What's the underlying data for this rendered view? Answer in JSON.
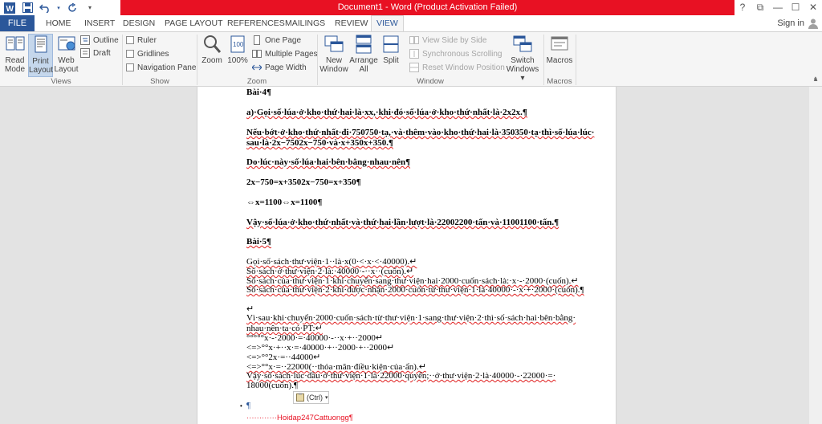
{
  "window": {
    "title": "Document1 - Word (Product Activation Failed)",
    "controls": {
      "help": "?",
      "restore": "⧉",
      "minimize": "—",
      "maximize": "☐",
      "close": "✕"
    }
  },
  "tabs": [
    "FILE",
    "HOME",
    "INSERT",
    "DESIGN",
    "PAGE LAYOUT",
    "REFERENCES",
    "MAILINGS",
    "REVIEW",
    "VIEW"
  ],
  "signin": "Sign in",
  "ribbon": {
    "views": {
      "label": "Views",
      "read_mode": [
        "Read",
        "Mode"
      ],
      "print_layout": [
        "Print",
        "Layout"
      ],
      "web_layout": [
        "Web",
        "Layout"
      ],
      "outline": "Outline",
      "draft": "Draft"
    },
    "show": {
      "label": "Show",
      "ruler": "Ruler",
      "gridlines": "Gridlines",
      "navigation_pane": "Navigation Pane"
    },
    "zoom": {
      "label": "Zoom",
      "zoom": "Zoom",
      "percent": "100%",
      "one_page": "One Page",
      "multiple_pages": "Multiple Pages",
      "page_width": "Page Width"
    },
    "window": {
      "label": "Window",
      "new_window": [
        "New",
        "Window"
      ],
      "arrange_all": [
        "Arrange",
        "All"
      ],
      "split": "Split",
      "view_side_by_side": "View Side by Side",
      "sync_scrolling": "Synchronous Scrolling",
      "reset_position": "Reset Window Position",
      "switch_windows": [
        "Switch",
        "Windows ▾"
      ]
    },
    "macros": {
      "label": "Macros",
      "macros": "Macros"
    }
  },
  "document": {
    "lines": [
      "Bài·4¶",
      "a)·Gọi·số·lúa·ở·kho·thứ·hai·là·xx,·khi·đó·số·lúa·ở·kho·thứ·nhất·là·2x2x.¶",
      "Nếu·bớt·ở·kho·thứ·nhất·đi·750750·tạ,·và·thêm·vào·kho·thứ·hai·là·350350·tạ·thì·số·lúa·lúc·",
      "sau·là·2x−7502x−750·và·x+350x+350.¶",
      "Do·lúc·này·số·lúa·hai·bên·bằng·nhau·nên¶",
      "2x−750=x+3502x−750=x+350¶",
      "⇔x=1100⇔x=1100¶",
      "Vậy·số·lúa·ở·kho·thứ·nhất·và·thứ·hai·lần·lượt·là·22002200·tấn·và·11001100·tấn.¶",
      "Bài·5¶",
      "Gọi·số·sách·thư·viện·1··là·x(0·<·x·<·40000).↵",
      "Số·sách·ở·thư·viện·2·là:·40000·-··x··(cuốn).↵",
      "Số·sách·của·thư·viện·1·khi·chuyển·sang·thư·viện·hai·2000·cuốn·sách·là:·x·-·2000·(cuốn).↵",
      "Số·sách·của·thư·viện·2·khi·được·nhận·2000·cuốn·từ·thư·viện·1·là·40000·-·x·+·2000·(cuốn).¶",
      "↵",
      "Vì·sau·khi·chuyển·2000·cuốn·sách·từ·thư·viện·1·sang·thư·viện·2·thì·số·sách·hai·bên·bằng·",
      "nhau·nên·ta·có·PT:↵",
      "°°°°°x·-·2000·=·40000·-··x·+··2000↵",
      "<=>°°x·+··x·=·40000·+··2000·+··2000↵",
      "<=>°°2x·=··44000↵",
      "<=>°°x·=··22000(··thỏa·mãn·điều·kiện·của·ẩn).↵",
      "Vậy·số·sách·lúc·đầu·ở·thư·viện·1·là·22000·quyển;··ở·thư·viện·2·là·40000·-·22000·=·",
      "18000(cuốn).¶",
      "¶",
      "············Hoidap247Cattuongg¶"
    ],
    "paste_options": "(Ctrl)"
  }
}
